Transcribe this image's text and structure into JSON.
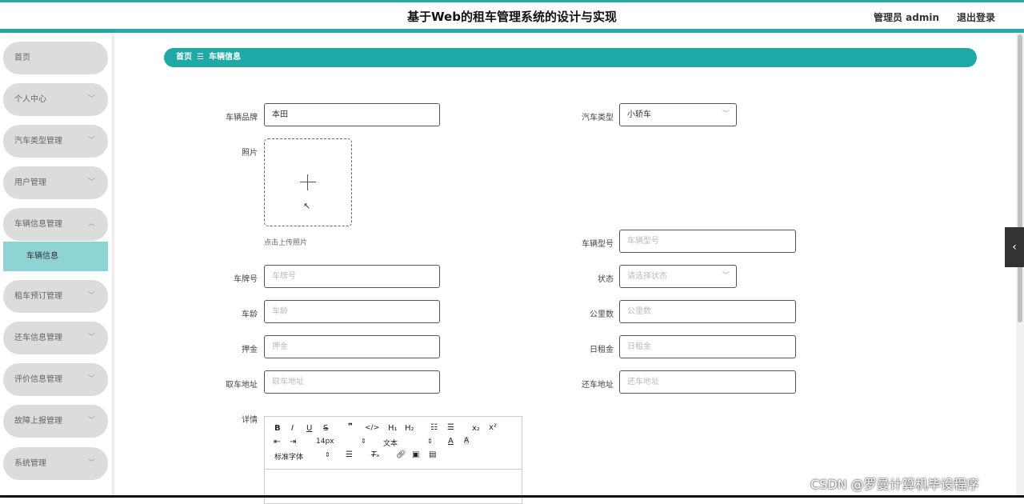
{
  "header": {
    "title": "基于Web的租车管理系统的设计与实现",
    "admin_label": "管理员 admin",
    "logout_label": "退出登录"
  },
  "sidebar": {
    "items": [
      {
        "label": "首页"
      },
      {
        "label": "个人中心"
      },
      {
        "label": "汽车类型管理"
      },
      {
        "label": "用户管理"
      },
      {
        "label": "车辆信息管理"
      },
      {
        "label": "租车预订管理"
      },
      {
        "label": "还车信息管理"
      },
      {
        "label": "评价信息管理"
      },
      {
        "label": "故障上报管理"
      },
      {
        "label": "系统管理"
      }
    ],
    "sub_item": "车辆信息"
  },
  "breadcrumb": {
    "home": "首页",
    "separator": "☰",
    "current": "车辆信息"
  },
  "form": {
    "brand": {
      "label": "车辆品牌",
      "value": "本田"
    },
    "car_type": {
      "label": "汽车类型",
      "value": "小轿车"
    },
    "photo": {
      "label": "照片",
      "hint": "点击上传照片"
    },
    "model": {
      "label": "车辆型号",
      "placeholder": "车辆型号"
    },
    "plate": {
      "label": "车牌号",
      "placeholder": "车牌号"
    },
    "status": {
      "label": "状态",
      "placeholder": "请选择状态"
    },
    "age": {
      "label": "车龄",
      "placeholder": "车龄"
    },
    "mileage": {
      "label": "公里数",
      "placeholder": "公里数"
    },
    "deposit": {
      "label": "押金",
      "placeholder": "押金"
    },
    "daily_rent": {
      "label": "日租金",
      "placeholder": "日租金"
    },
    "pickup": {
      "label": "取车地址",
      "placeholder": "取车地址"
    },
    "return": {
      "label": "还车地址",
      "placeholder": "还车地址"
    },
    "details": {
      "label": "详情"
    }
  },
  "editor": {
    "font_size": "14px",
    "text_style": "文本",
    "font_family": "标准字体"
  },
  "watermark": "CSDN @罗曼计算机毕设程序",
  "colors": {
    "accent": "#1fa8a8",
    "submenu": "#8fd4d4",
    "menu_bg": "#dcdcdc"
  }
}
